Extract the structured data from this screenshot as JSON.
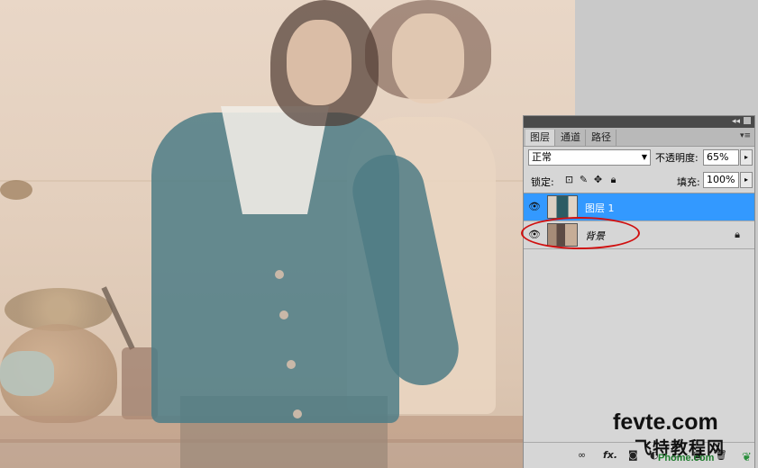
{
  "watermark": {
    "domain": "fevte.com",
    "cn_text": "飞特教程网",
    "phome": "Phome.com"
  },
  "layers_panel": {
    "collapse_icon": "double-arrow",
    "tabs": [
      {
        "label": "图层",
        "active": true
      },
      {
        "label": "通道",
        "active": false
      },
      {
        "label": "路径",
        "active": false
      }
    ],
    "blend_mode": "正常",
    "opacity_label": "不透明度:",
    "opacity_value": "65%",
    "lock_label": "锁定:",
    "lock_icons": [
      "lock-transparent-icon",
      "lock-brush-icon",
      "lock-move-icon",
      "lock-all-icon"
    ],
    "fill_label": "填充:",
    "fill_value": "100%",
    "layers": [
      {
        "name": "图层 1",
        "selected": true,
        "visible": true,
        "locked": false
      },
      {
        "name": "背景",
        "selected": false,
        "visible": true,
        "locked": true
      }
    ],
    "annotation_color": "#d01010",
    "selected_color": "#3399ff",
    "bottom_icons": [
      "link-icon",
      "fx-icon",
      "mask-icon",
      "adjustment-icon",
      "group-icon",
      "new-layer-icon",
      "trash-icon"
    ]
  }
}
